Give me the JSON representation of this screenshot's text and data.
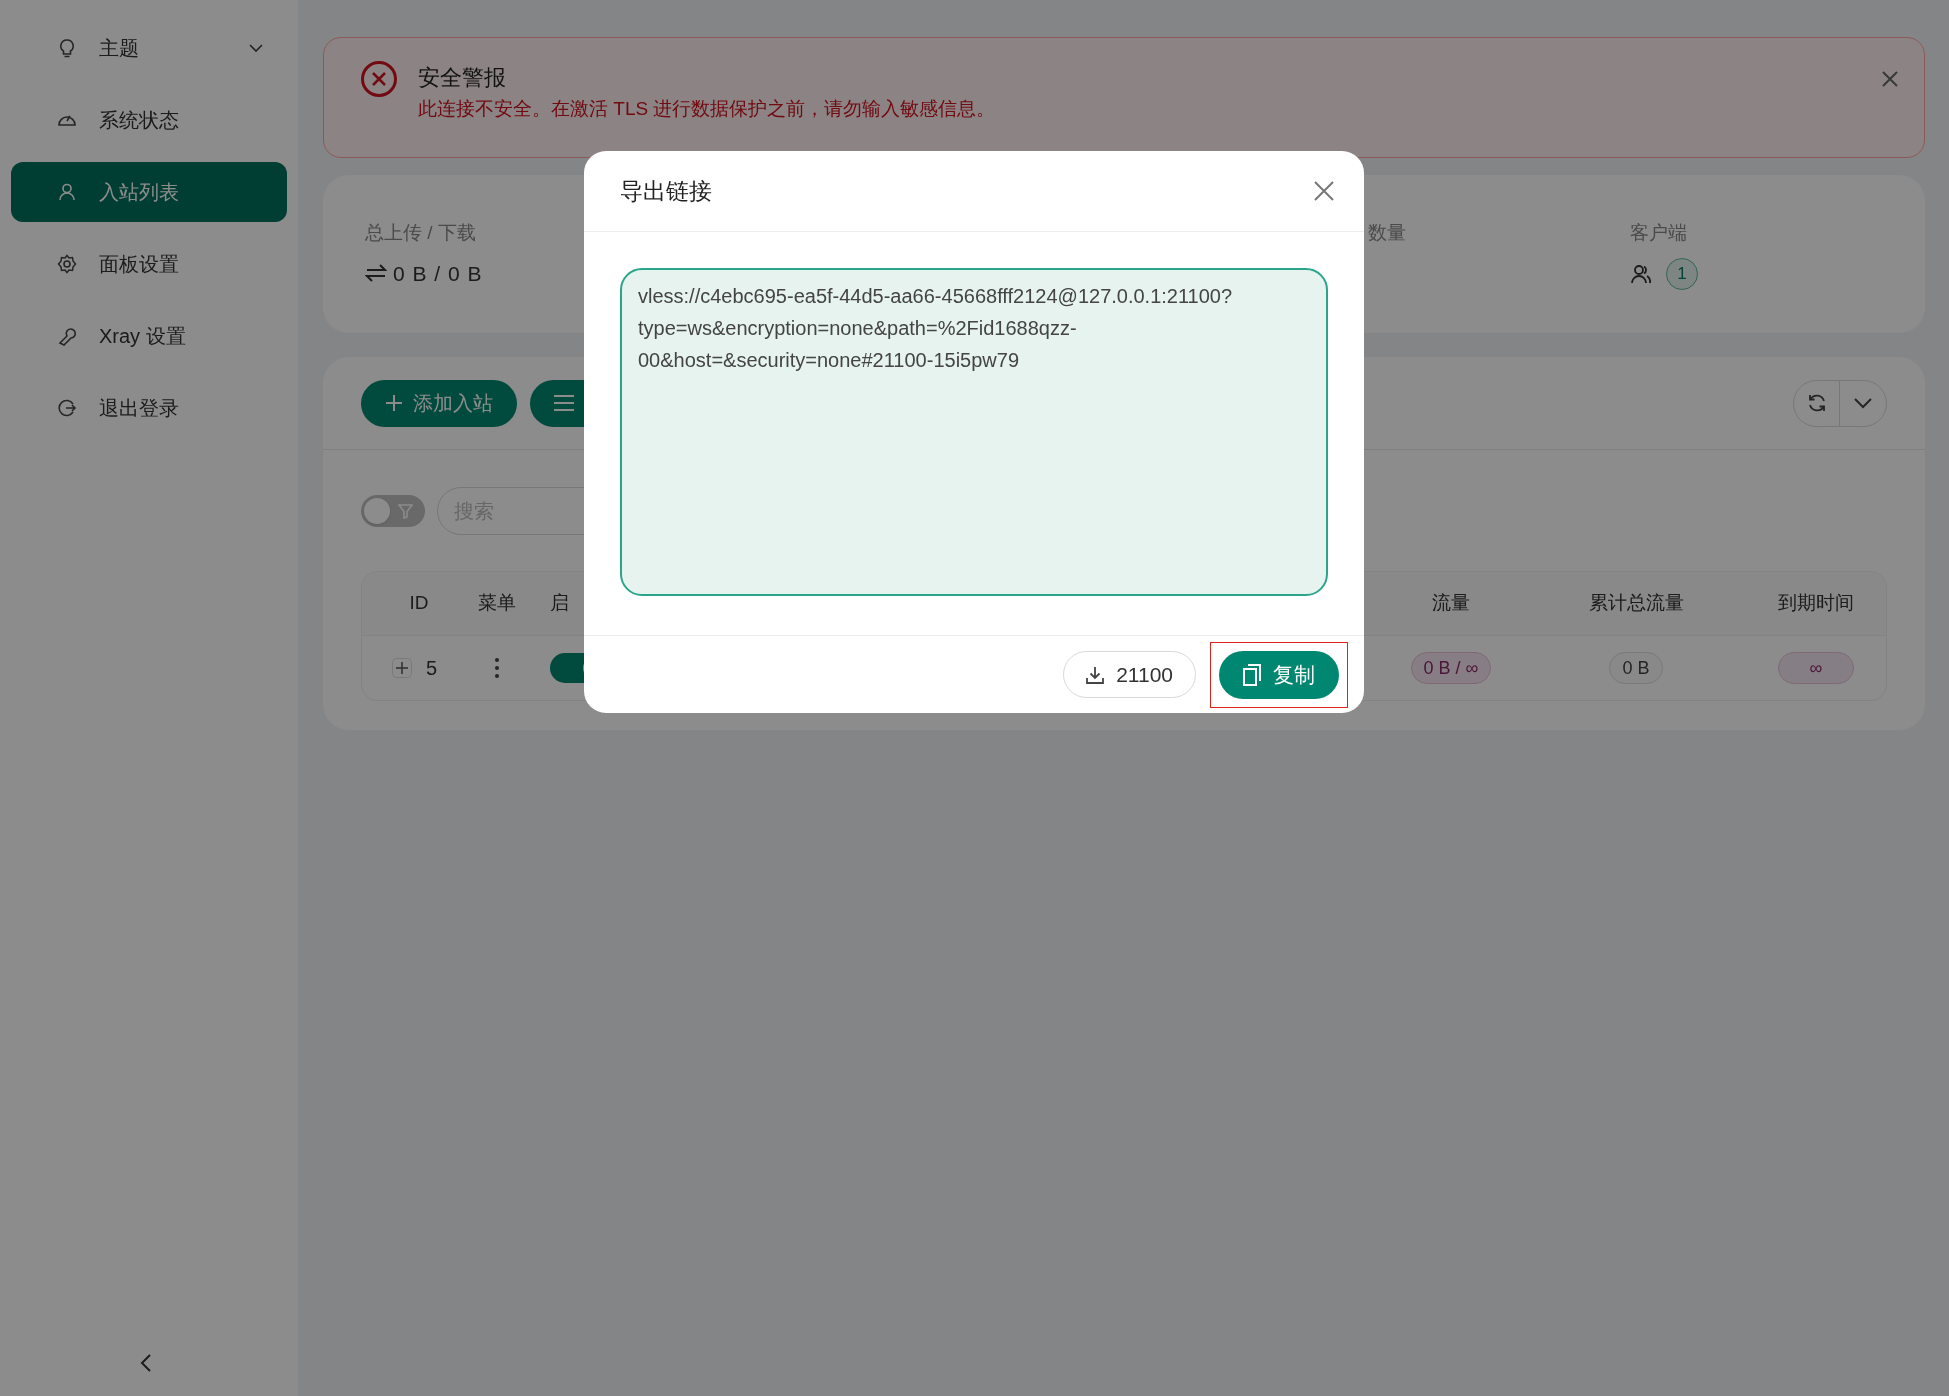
{
  "sidebar": {
    "items": [
      {
        "label": "主题",
        "selected": false,
        "kind": "submenu"
      },
      {
        "label": "系统状态",
        "selected": false,
        "kind": "link"
      },
      {
        "label": "入站列表",
        "selected": true,
        "kind": "link"
      },
      {
        "label": "面板设置",
        "selected": false,
        "kind": "link"
      },
      {
        "label": "Xray 设置",
        "selected": false,
        "kind": "link"
      },
      {
        "label": "退出登录",
        "selected": false,
        "kind": "link"
      }
    ]
  },
  "alert": {
    "title": "安全警报",
    "message": "此连接不安全。在激活 TLS 进行数据保护之前，请勿输入敏感信息。"
  },
  "stats": [
    {
      "label": "总上传 / 下载",
      "value": "0 B / 0 B",
      "kind": "traffic"
    },
    {
      "label": "数量",
      "kind": "plain"
    },
    {
      "label": "客户端",
      "value": "1",
      "kind": "clients"
    }
  ],
  "toolbar": {
    "add_button": "添加入站"
  },
  "filter": {
    "on": false,
    "search_placeholder": "搜索"
  },
  "table": {
    "columns": [
      "ID",
      "菜单",
      "启",
      "流量",
      "累计总流量",
      "到期时间"
    ],
    "rows": [
      {
        "id": "5",
        "enabled": true,
        "traffic": "0 B / ∞",
        "total_traffic": "0 B",
        "expiry": "∞"
      }
    ]
  },
  "modal": {
    "title": "导出链接",
    "link": "vless://c4ebc695-ea5f-44d5-aa66-45668fff2124@127.0.0.1:21100?type=ws&encryption=none&path=%2Fid1688qzz-00&host=&security=none#21100-15i5pw79",
    "download_button": "21100",
    "copy_button": "复制",
    "copy_highlighted": true
  }
}
